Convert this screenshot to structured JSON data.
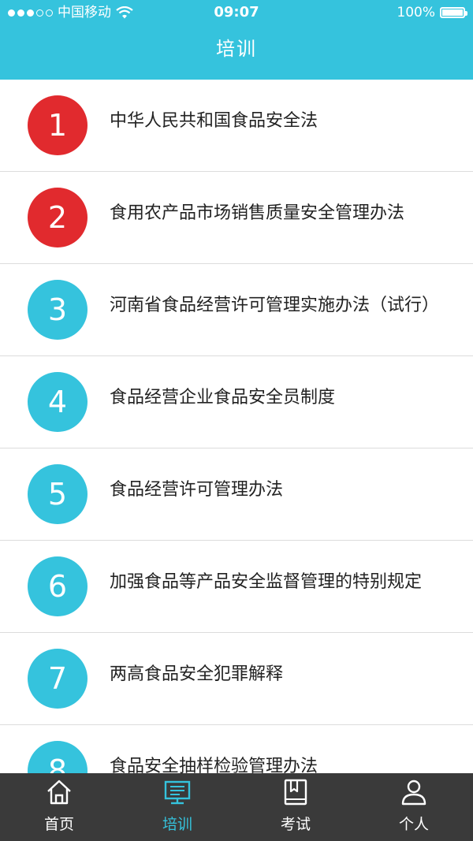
{
  "status": {
    "carrier": "中国移动",
    "time": "09:07",
    "battery": "100%"
  },
  "header": {
    "title": "培训"
  },
  "colors": {
    "accent": "#35c3dd",
    "highlight": "#e12a2e",
    "tabbar": "#3a3a3a"
  },
  "items": [
    {
      "num": "1",
      "label": "中华人民共和国食品安全法",
      "color": "red"
    },
    {
      "num": "2",
      "label": "食用农产品市场销售质量安全管理办法",
      "color": "red"
    },
    {
      "num": "3",
      "label": "河南省食品经营许可管理实施办法（试行）",
      "color": "blue"
    },
    {
      "num": "4",
      "label": "食品经营企业食品安全员制度",
      "color": "blue"
    },
    {
      "num": "5",
      "label": "食品经营许可管理办法",
      "color": "blue"
    },
    {
      "num": "6",
      "label": "加强食品等产品安全监督管理的特别规定",
      "color": "blue"
    },
    {
      "num": "7",
      "label": "两高食品安全犯罪解释",
      "color": "blue"
    },
    {
      "num": "8",
      "label": "食品安全抽样检验管理办法",
      "color": "blue"
    }
  ],
  "tabs": [
    {
      "label": "首页",
      "icon": "home-icon",
      "active": false
    },
    {
      "label": "培训",
      "icon": "training-icon",
      "active": true
    },
    {
      "label": "考试",
      "icon": "book-icon",
      "active": false
    },
    {
      "label": "个人",
      "icon": "user-icon",
      "active": false
    }
  ]
}
